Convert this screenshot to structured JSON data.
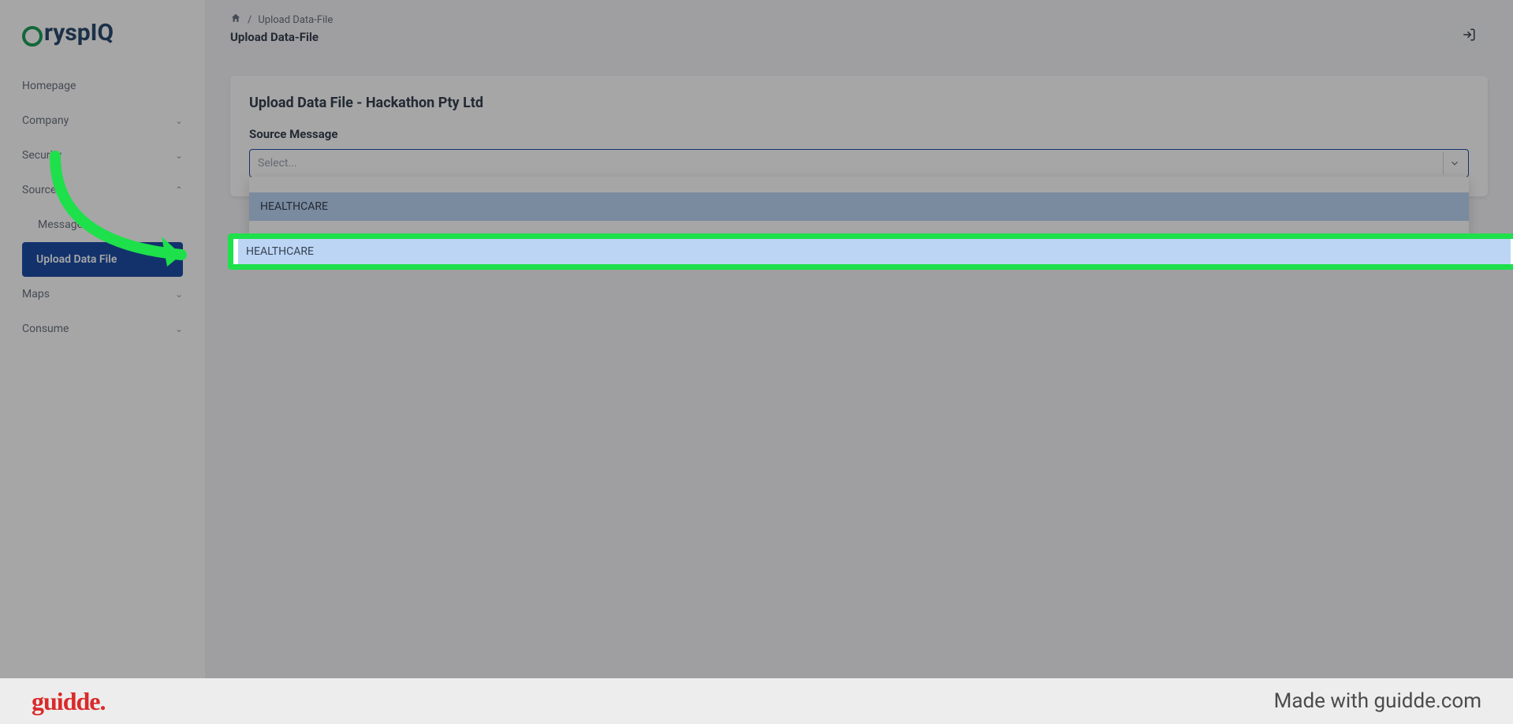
{
  "logo": {
    "text": "CryspIQ"
  },
  "sidebar": {
    "items": [
      {
        "label": "Homepage",
        "expandable": false
      },
      {
        "label": "Company",
        "expandable": true
      },
      {
        "label": "Security",
        "expandable": true
      },
      {
        "label": "Source",
        "expandable": true,
        "expanded": true
      },
      {
        "label": "Messages",
        "sub": true
      },
      {
        "label": "Upload Data File",
        "sub": true,
        "active": true
      },
      {
        "label": "Maps",
        "expandable": true
      },
      {
        "label": "Consume",
        "expandable": true
      }
    ]
  },
  "breadcrumb": {
    "separator": "/",
    "current": "Upload Data-File"
  },
  "page_title": "Upload Data-File",
  "card": {
    "title": "Upload Data File - Hackathon Pty Ltd",
    "field_label": "Source Message",
    "select_placeholder": "Select..."
  },
  "dropdown": {
    "option_highlighted": "HEALTHCARE"
  },
  "footer": {
    "logo": "guidde.",
    "made_with": "Made with guidde.com"
  }
}
